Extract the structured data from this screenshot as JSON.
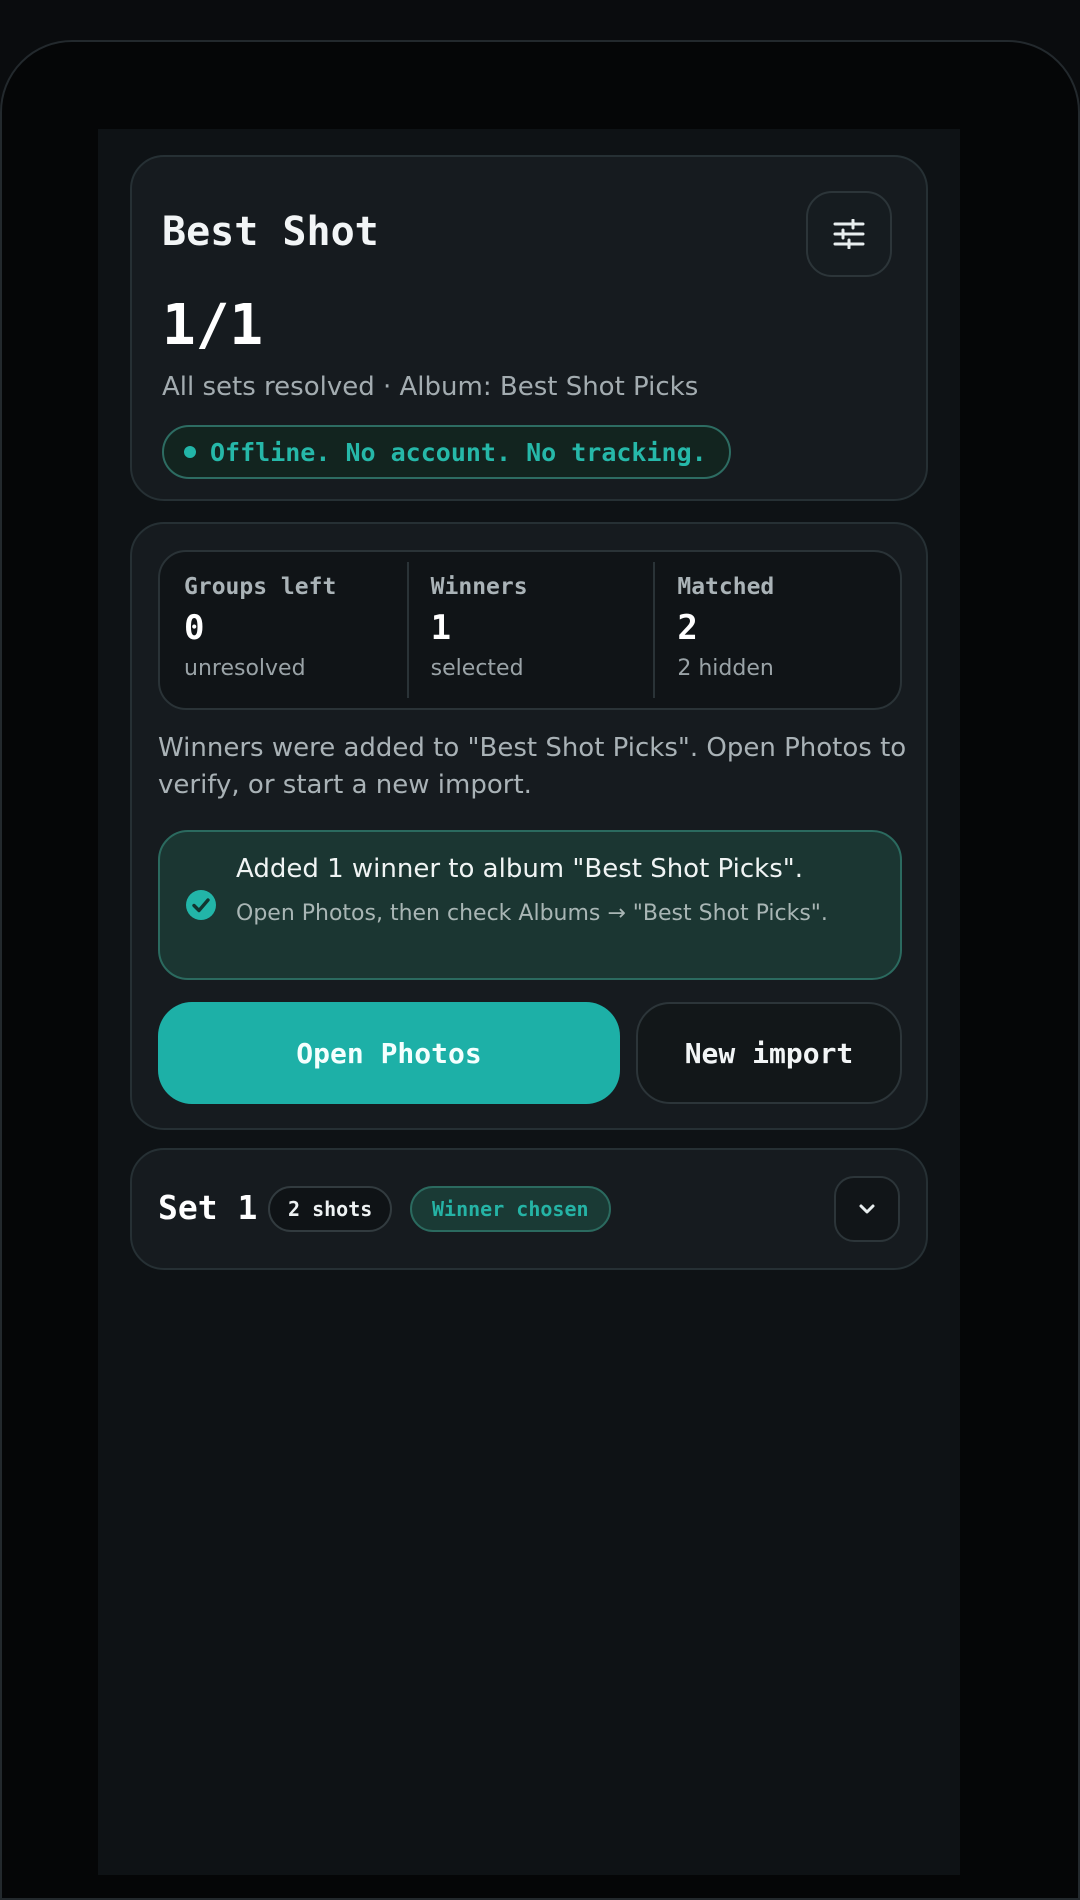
{
  "header": {
    "title": "Best Shot",
    "progress": "1/1",
    "subtitle": "All sets resolved · Album: Best Shot Picks",
    "privacy_badge": "Offline. No account. No tracking.",
    "settings_icon": "sliders-icon"
  },
  "stats": [
    {
      "label": "Groups left",
      "value": "0",
      "note": "unresolved"
    },
    {
      "label": "Winners",
      "value": "1",
      "note": "selected"
    },
    {
      "label": "Matched",
      "value": "2",
      "note": "2 hidden"
    }
  ],
  "summary": {
    "text": "Winners were added to \"Best Shot Picks\". Open Photos to verify, or start a new import.",
    "notice_title": "Added 1 winner to album \"Best Shot Picks\".",
    "notice_sub": "Open Photos, then check Albums → \"Best Shot Picks\".",
    "notice_icon": "check-circle-icon"
  },
  "actions": {
    "open_photos": "Open Photos",
    "new_import": "New import"
  },
  "set": {
    "title": "Set 1",
    "shots": "2 shots",
    "status": "Winner chosen",
    "expand_icon": "chevron-down-icon"
  },
  "colors": {
    "accent": "#1db0a7",
    "background": "#0e1215",
    "card": "#161b1f",
    "success_bg": "#1b3632"
  }
}
